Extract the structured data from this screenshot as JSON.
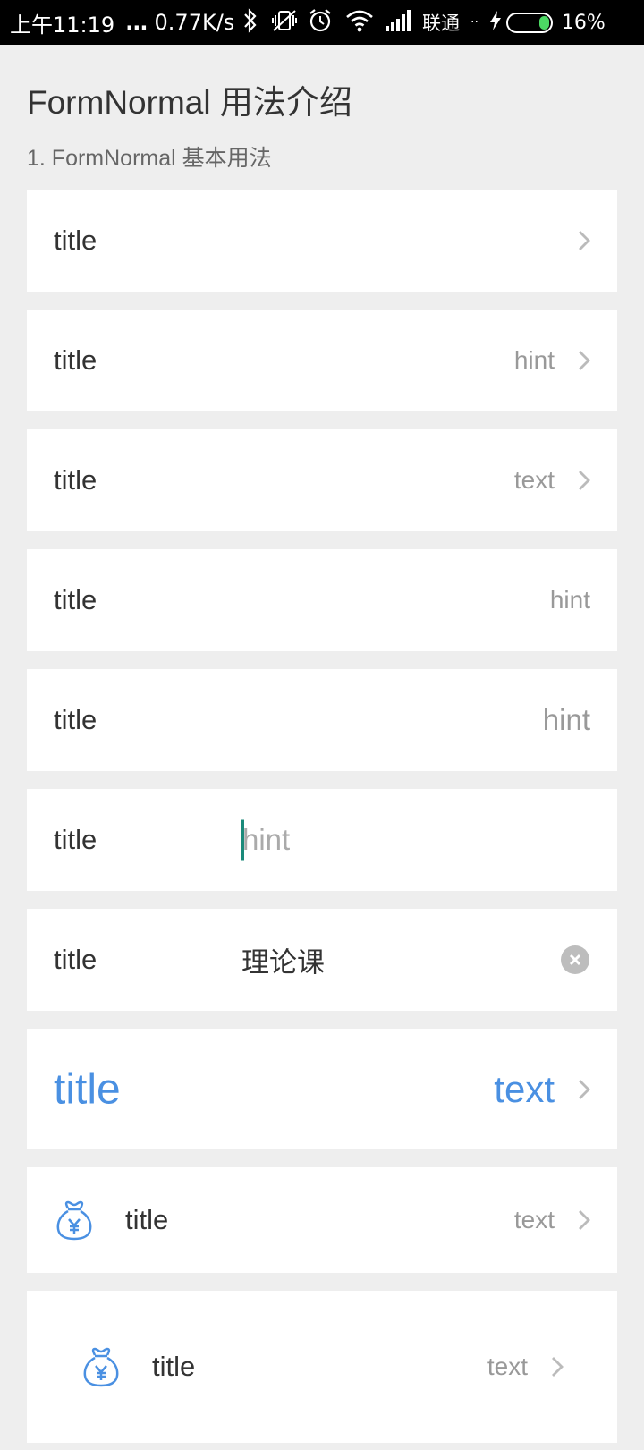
{
  "status_bar": {
    "time": "上午11:19",
    "dots": "...",
    "speed": "0.77K/s",
    "carrier": "联通",
    "extra_dots": "··",
    "battery_percent": "16%",
    "battery_level": 0.16,
    "icons": [
      "bluetooth-icon",
      "vibrate-off-icon",
      "alarm-icon",
      "wifi-icon",
      "signal-icon",
      "charging-icon",
      "battery-icon"
    ]
  },
  "page": {
    "title": "FormNormal 用法介绍",
    "section": "1. FormNormal 基本用法"
  },
  "rows": [
    {
      "title": "title",
      "right": "",
      "type": "arrow"
    },
    {
      "title": "title",
      "right": "hint",
      "type": "arrow"
    },
    {
      "title": "title",
      "right": "text",
      "type": "arrow"
    },
    {
      "title": "title",
      "right": "hint",
      "type": "plain"
    },
    {
      "title": "title",
      "right": "hint",
      "type": "plain-large"
    },
    {
      "title": "title",
      "placeholder": "hint",
      "type": "input-empty"
    },
    {
      "title": "title",
      "value": "理论课",
      "type": "input-filled"
    },
    {
      "title": "title",
      "right": "text",
      "type": "arrow-large-blue"
    },
    {
      "title": "title",
      "right": "text",
      "type": "icon-arrow",
      "icon": "money-bag-icon"
    },
    {
      "title": "title",
      "right": "text",
      "type": "icon-arrow-padded",
      "icon": "money-bag-icon"
    }
  ],
  "colors": {
    "background": "#eeeeee",
    "row_bg": "#ffffff",
    "title_text": "#333333",
    "hint_text": "#999999",
    "accent_blue": "#4a90e2",
    "cursor": "#1a8a7a",
    "clear_icon": "#bdbdbd"
  }
}
